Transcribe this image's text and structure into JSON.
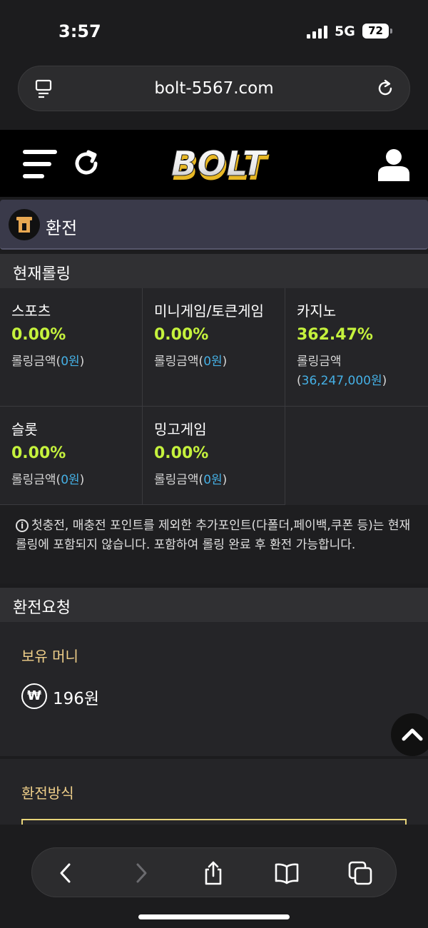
{
  "status_bar": {
    "time": "3:57",
    "network": "5G",
    "battery": "72"
  },
  "browser": {
    "url": "bolt-5567.com"
  },
  "header": {
    "logo_text": "BOLT"
  },
  "page": {
    "title": "환전"
  },
  "rolling": {
    "heading": "현재롤링",
    "cells": [
      {
        "title": "스포츠",
        "percent": "0.00%",
        "amount_label": "롤링금액(",
        "amount": "0원",
        "amount_close": ")"
      },
      {
        "title": "미니게임/토큰게임",
        "percent": "0.00%",
        "amount_label": "롤링금액(",
        "amount": "0원",
        "amount_close": ")"
      },
      {
        "title": "카지노",
        "percent": "362.47%",
        "amount_label": "롤링금액",
        "amount_open": "(",
        "amount": "36,247,000원",
        "amount_close": ")"
      },
      {
        "title": "슬롯",
        "percent": "0.00%",
        "amount_label": "롤링금액(",
        "amount": "0원",
        "amount_close": ")"
      },
      {
        "title": "밍고게임",
        "percent": "0.00%",
        "amount_label": "롤링금액(",
        "amount": "0원",
        "amount_close": ")"
      }
    ],
    "notice": "첫충전, 매충전 포인트를 제외한 추가포인트(다폴더,페이백,쿠폰 등)는 현재 롤링에 포함되지 않습니다. 포함하여 롤링 완료 후 환전 가능합니다."
  },
  "request": {
    "heading": "환전요청",
    "balance_label": "보유 머니",
    "currency_symbol": "₩",
    "balance_value": "196원"
  },
  "method": {
    "label": "환전방식"
  },
  "colors": {
    "accent_green": "#c5f23d",
    "link_blue": "#45b0e5",
    "gold_label": "#f0d08a"
  },
  "icons": [
    "reader-icon",
    "reload-icon",
    "menu-icon",
    "refresh-icon",
    "user-icon",
    "exchange-icon",
    "info-icon",
    "won-icon",
    "chevron-up-icon",
    "back-icon",
    "forward-icon",
    "share-icon",
    "bookmarks-icon",
    "tabs-icon"
  ]
}
